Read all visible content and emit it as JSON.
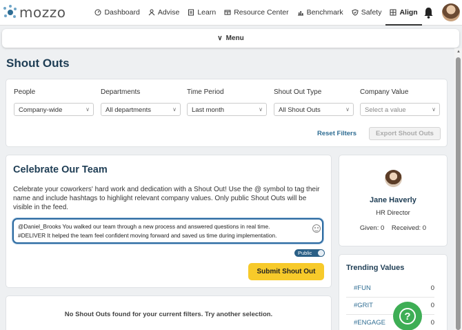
{
  "brand": {
    "name": "mozzo"
  },
  "nav": [
    {
      "label": "Dashboard",
      "icon": "dashboard-icon",
      "active": false
    },
    {
      "label": "Advise",
      "icon": "advise-icon",
      "active": false
    },
    {
      "label": "Learn",
      "icon": "learn-icon",
      "active": false
    },
    {
      "label": "Resource Center",
      "icon": "resource-center-icon",
      "active": false
    },
    {
      "label": "Benchmark",
      "icon": "benchmark-icon",
      "active": false
    },
    {
      "label": "Safety",
      "icon": "shield-icon",
      "active": false
    },
    {
      "label": "Align",
      "icon": "grid-icon",
      "active": true
    }
  ],
  "menubar": {
    "label": "Menu"
  },
  "page": {
    "title": "Shout Outs"
  },
  "filters": {
    "people": {
      "label": "People",
      "value": "Company-wide"
    },
    "departments": {
      "label": "Departments",
      "value": "All departments"
    },
    "time_period": {
      "label": "Time Period",
      "value": "Last month"
    },
    "type": {
      "label": "Shout Out Type",
      "value": "All Shout Outs"
    },
    "company_value": {
      "label": "Company Value",
      "placeholder": "Select a value"
    },
    "reset_label": "Reset Filters",
    "export_label": "Export Shout Outs"
  },
  "celebrate": {
    "title": "Celebrate Our Team",
    "description": "Celebrate your coworkers' hard work and dedication with a Shout Out! Use the @ symbol to tag their name and include hashtags to highlight relevant company values. Only public Shout Outs will be visible in the feed.",
    "message_line1": "@Daniel_Brooks You walked our team through a new process and answered questions in real time.",
    "message_line2": "#DELIVER It helped the team feel confident moving forward and saved us time during implementation.",
    "visibility_label": "Public",
    "submit_label": "Submit Shout Out"
  },
  "empty_state": {
    "message": "No Shout Outs found for your current filters. Try another selection."
  },
  "profile": {
    "name": "Jane Haverly",
    "role": "HR Director",
    "given": "Given: 0",
    "received": "Received: 0"
  },
  "trending": {
    "title": "Trending Values",
    "items": [
      {
        "tag": "#FUN",
        "count": "0"
      },
      {
        "tag": "#GRIT",
        "count": "0"
      },
      {
        "tag": "#ENGAGE",
        "count": "0"
      }
    ]
  },
  "colors": {
    "accent_blue": "#2f6d93",
    "title_navy": "#1e3d54",
    "submit_yellow": "#f7ca2a",
    "help_green": "#3eae55"
  }
}
